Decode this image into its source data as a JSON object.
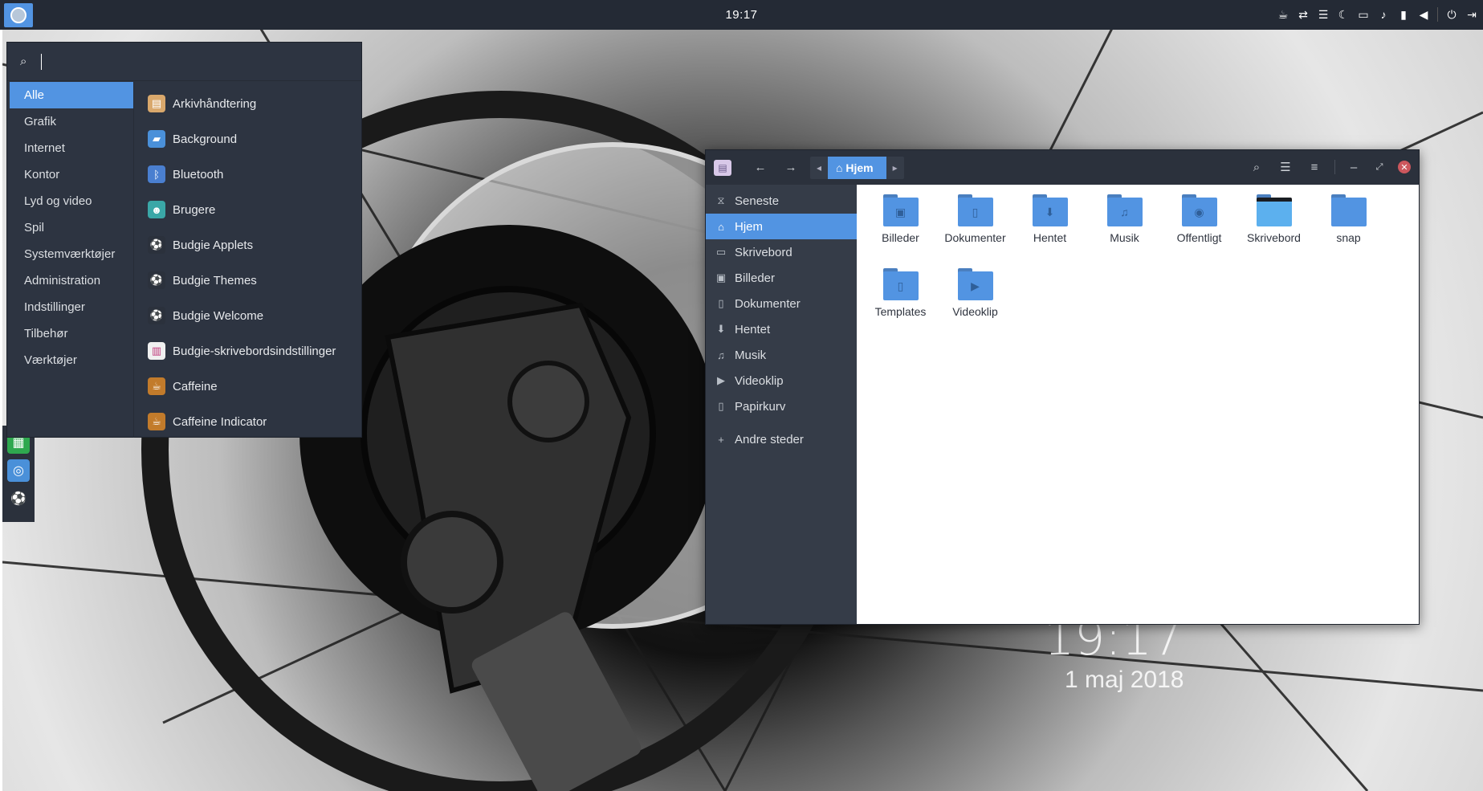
{
  "topbar": {
    "clock": "19:17",
    "tray_icons": [
      "coffee-icon",
      "network-icon",
      "menu-icon",
      "night-icon",
      "folder-icon",
      "notification-icon",
      "battery-icon",
      "volume-icon",
      "power-icon",
      "logout-icon"
    ]
  },
  "app_menu": {
    "search": {
      "placeholder": ""
    },
    "categories": [
      "Alle",
      "Grafik",
      "Internet",
      "Kontor",
      "Lyd og video",
      "Spil",
      "Systemværktøjer",
      "Administration",
      "Indstillinger",
      "Tilbehør",
      "Værktøjer"
    ],
    "selected_category": "Alle",
    "apps": [
      {
        "label": "Arkivhåndtering",
        "icon": "archive-icon",
        "color": "#d9a86c"
      },
      {
        "label": "Background",
        "icon": "background-icon",
        "color": "#4a90d9"
      },
      {
        "label": "Bluetooth",
        "icon": "bluetooth-icon",
        "color": "#4a7fd0"
      },
      {
        "label": "Brugere",
        "icon": "users-icon",
        "color": "#3aa7a7"
      },
      {
        "label": "Budgie Applets",
        "icon": "budgie-icon",
        "color": "#2b313c"
      },
      {
        "label": "Budgie Themes",
        "icon": "budgie-icon",
        "color": "#2b313c"
      },
      {
        "label": "Budgie Welcome",
        "icon": "budgie-icon",
        "color": "#2b313c"
      },
      {
        "label": "Budgie-skrivebordsindstillinger",
        "icon": "settings-icon",
        "color": "#f0f0f0"
      },
      {
        "label": "Caffeine",
        "icon": "caffeine-icon",
        "color": "#c27b2b"
      },
      {
        "label": "Caffeine Indicator",
        "icon": "caffeine-icon",
        "color": "#c27b2b"
      }
    ]
  },
  "file_manager": {
    "location": "Hjem",
    "sidebar": [
      {
        "label": "Seneste",
        "icon": "recent-icon"
      },
      {
        "label": "Hjem",
        "icon": "home-icon",
        "active": true
      },
      {
        "label": "Skrivebord",
        "icon": "desktop-icon"
      },
      {
        "label": "Billeder",
        "icon": "pictures-icon"
      },
      {
        "label": "Dokumenter",
        "icon": "documents-icon"
      },
      {
        "label": "Hentet",
        "icon": "downloads-icon"
      },
      {
        "label": "Musik",
        "icon": "music-icon"
      },
      {
        "label": "Videoklip",
        "icon": "videos-icon"
      },
      {
        "label": "Papirkurv",
        "icon": "trash-icon"
      },
      {
        "label": "Andre steder",
        "icon": "plus-icon"
      }
    ],
    "items": [
      {
        "label": "Billeder",
        "glyph": "▣"
      },
      {
        "label": "Dokumenter",
        "glyph": "▯"
      },
      {
        "label": "Hentet",
        "glyph": "⬇"
      },
      {
        "label": "Musik",
        "glyph": "♫"
      },
      {
        "label": "Offentligt",
        "glyph": "◉"
      },
      {
        "label": "Skrivebord",
        "glyph": "",
        "desk": true
      },
      {
        "label": "snap",
        "glyph": ""
      },
      {
        "label": "Templates",
        "glyph": "▯"
      },
      {
        "label": "Videoklip",
        "glyph": "▶"
      }
    ]
  },
  "desktop": {
    "lock_time": "19:17",
    "lock_date": "1 maj 2018"
  }
}
